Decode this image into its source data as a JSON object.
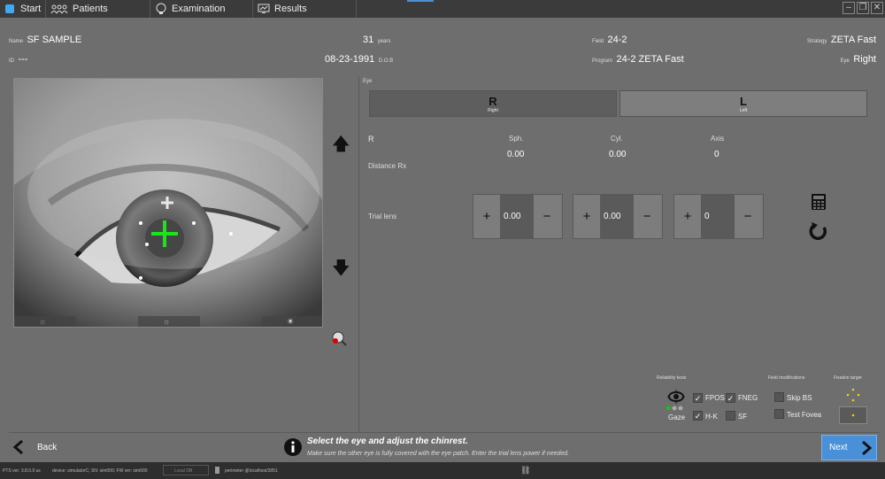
{
  "tabs": [
    {
      "label": "Start",
      "icon": "app-logo-icon"
    },
    {
      "label": "Patients",
      "icon": "patients-icon"
    },
    {
      "label": "Examination",
      "icon": "head-icon"
    },
    {
      "label": "Results",
      "icon": "results-monitor-icon"
    }
  ],
  "patient": {
    "name_label": "Name",
    "name": "SF SAMPLE",
    "id_label": "ID",
    "id": "---",
    "age": "31",
    "age_unit": "years",
    "dob": "08-23-1991",
    "dob_label": "D.O.B",
    "field_label": "Field",
    "field": "24-2",
    "program_label": "Program",
    "program": "24-2 ZETA Fast",
    "strategy_label": "Strategy",
    "strategy": "ZETA Fast",
    "eye_label": "Eye",
    "eye": "Right"
  },
  "eye_section": {
    "label": "Eye",
    "right": {
      "letter": "R",
      "label": "Right"
    },
    "left": {
      "letter": "L",
      "label": "Left"
    }
  },
  "rx": {
    "eye": "R",
    "distance_label": "Distance Rx",
    "sph_label": "Sph.",
    "cyl_label": "Cyl.",
    "axis_label": "Axis",
    "sph": "0.00",
    "cyl": "0.00",
    "axis": "0",
    "trial_label": "Trial lens",
    "trial_sph": "0.00",
    "trial_cyl": "0.00",
    "trial_axis": "0"
  },
  "reliability": {
    "title": "Reliability tests",
    "fpos": "FPOS",
    "fneg": "FNEG",
    "gaze": "Gaze",
    "hk": "H-K",
    "sf": "SF",
    "fpos_checked": true,
    "fneg_checked": true,
    "hk_checked": true,
    "sf_checked": false
  },
  "field_mod": {
    "title": "Field modifications",
    "skip_bs": "Skip BS",
    "test_fovea": "Test Fovea"
  },
  "fixation": {
    "title": "Fixation target"
  },
  "footer": {
    "back": "Back",
    "next": "Next",
    "instruction": "Select the eye and adjust the chinrest.",
    "sub": "Make sure the other eye is fully covered with the eye patch. Enter the trial lens power if needed."
  },
  "status": {
    "version": "PTS ver: 3.8.0.9 us",
    "device": "device: simulatorC; SN: sim000; FW ver: sim000",
    "db": "Local DB",
    "server": "perimeter @localhost/3051"
  },
  "colors": {
    "accent": "#4a90d9",
    "cross": "#19e619",
    "fixation": "#f0d000"
  }
}
